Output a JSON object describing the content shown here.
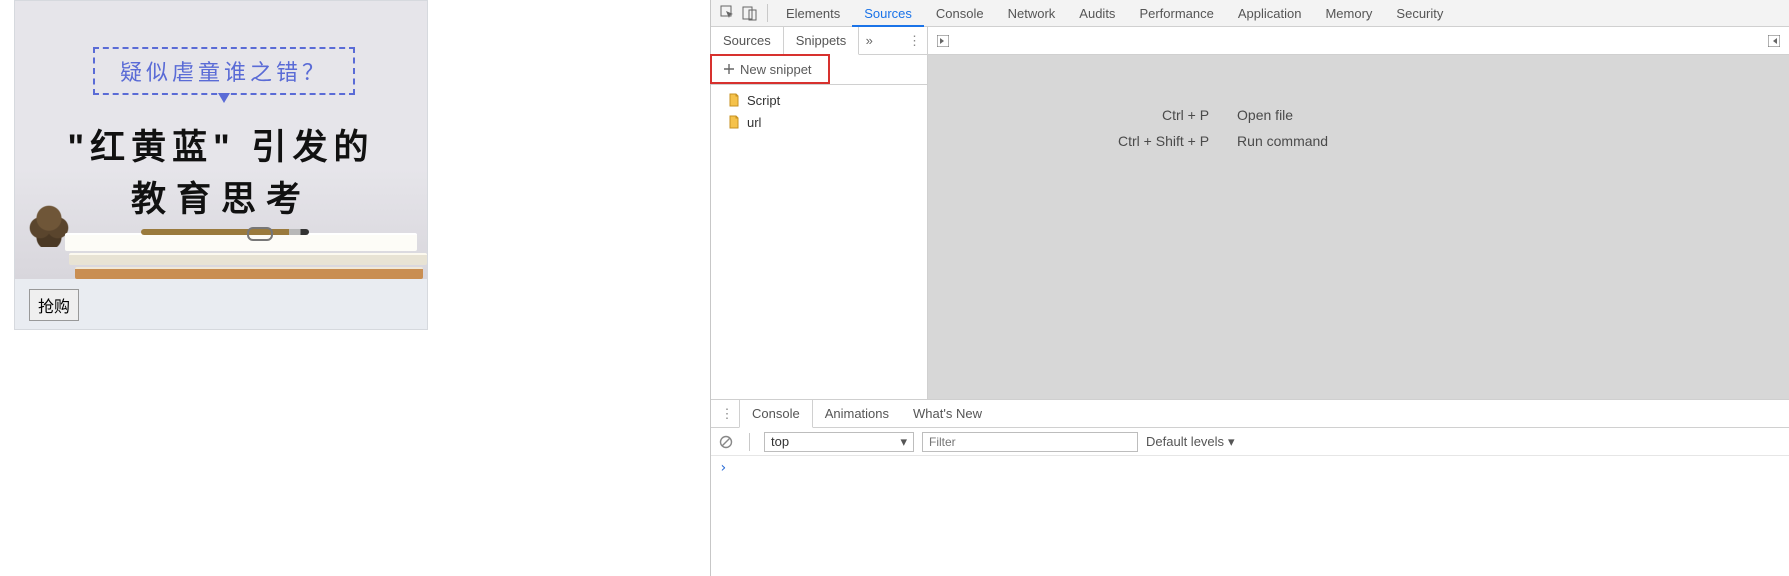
{
  "ad": {
    "question": "疑似虐童谁之错？",
    "line1": "\"红黄蓝\" 引发的",
    "line2": "教育思考",
    "buy_label": "抢购"
  },
  "devtools": {
    "top_tabs": [
      "Elements",
      "Sources",
      "Console",
      "Network",
      "Audits",
      "Performance",
      "Application",
      "Memory",
      "Security"
    ],
    "top_active": "Sources",
    "sources_side": {
      "tabs": [
        "Sources",
        "Snippets"
      ],
      "tabs_active": "Snippets",
      "overflow_glyph": "»",
      "new_snippet_label": "New snippet",
      "items": [
        "Script",
        "url"
      ]
    },
    "editor_hints": [
      {
        "shortcut": "Ctrl + P",
        "label": "Open file"
      },
      {
        "shortcut": "Ctrl + Shift + P",
        "label": "Run command"
      }
    ],
    "drawer": {
      "tabs": [
        "Console",
        "Animations",
        "What's New"
      ],
      "tabs_active": "Console",
      "context": "top",
      "filter_placeholder": "Filter",
      "levels_label": "Default levels",
      "prompt_glyph": "›"
    }
  }
}
